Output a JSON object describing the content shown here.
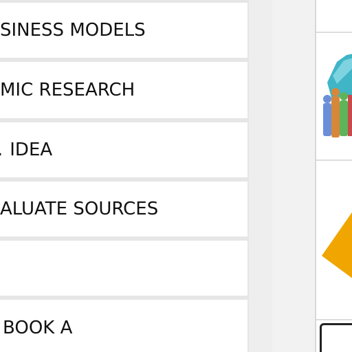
{
  "menu": {
    "items": [
      {
        "label": "SINESS MODELS"
      },
      {
        "label": "MIC RESEARCH"
      },
      {
        "label": "IDEA"
      },
      {
        "label": "ALUATE SOURCES"
      },
      {
        "label": ""
      },
      {
        "label": "BOOK A"
      }
    ]
  },
  "thumbnails": [
    {
      "icon": "people-bar-chart-icon"
    },
    {
      "icon": "pie-chart-icon"
    },
    {
      "icon": "framed-box-icon"
    }
  ],
  "colors": {
    "menu_background": "#ffffff",
    "panel_background": "#e6e6e6",
    "text": "#111111",
    "accent_orange": "#f0a500",
    "accent_teal": "#3fb5c6"
  }
}
